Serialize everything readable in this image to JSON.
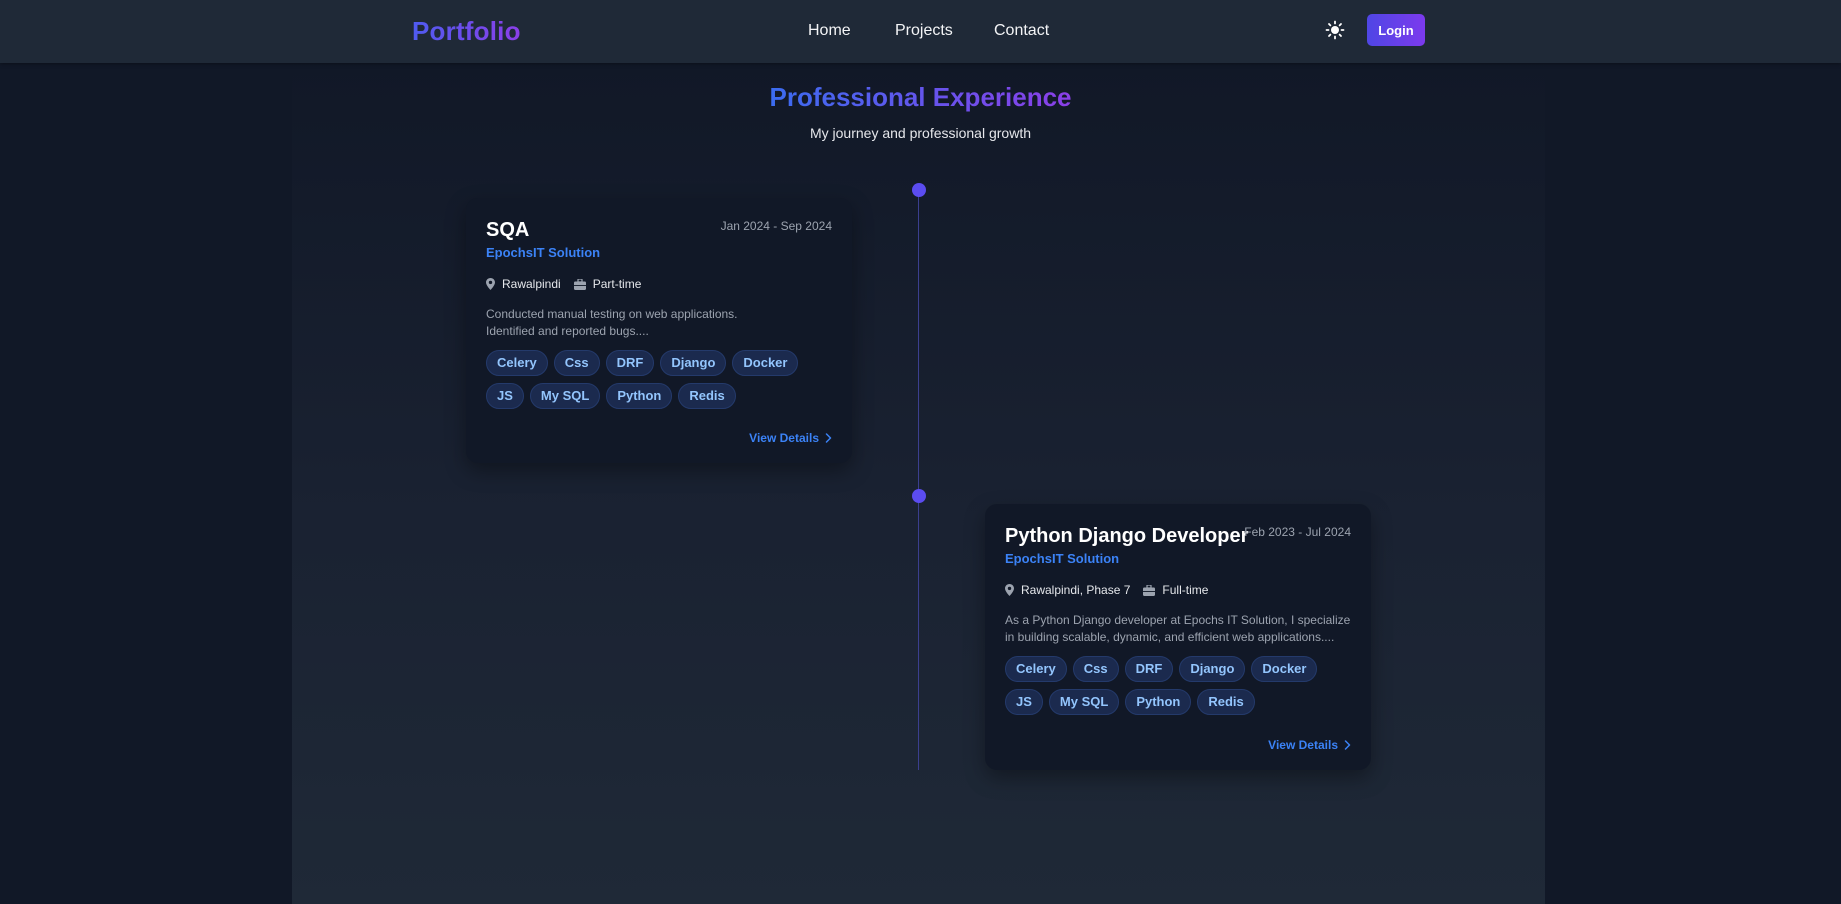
{
  "header": {
    "logo": "Portfolio",
    "nav": [
      {
        "label": "Home"
      },
      {
        "label": "Projects"
      },
      {
        "label": "Contact"
      }
    ],
    "theme_icon": "sun-icon",
    "login_label": "Login"
  },
  "section": {
    "title": "Professional Experience",
    "subtitle": "My journey and professional growth"
  },
  "experiences": [
    {
      "title": "SQA",
      "date": "Jan 2024 - Sep 2024",
      "company": "EpochsIT Solution",
      "location": "Rawalpindi",
      "type": "Part-time",
      "description": "Conducted manual testing on web applications.\nIdentified and reported bugs....",
      "tags": [
        "Celery",
        "Css",
        "DRF",
        "Django",
        "Docker",
        "JS",
        "My SQL",
        "Python",
        "Redis"
      ],
      "link_label": "View Details"
    },
    {
      "title": "Python Django Developer",
      "date": "Feb 2023 - Jul 2024",
      "company": "EpochsIT Solution",
      "location": "Rawalpindi, Phase 7",
      "type": "Full-time",
      "description": "As a Python Django developer at Epochs IT Solution, I specialize in building scalable, dynamic, and efficient web applications....",
      "tags": [
        "Celery",
        "Css",
        "DRF",
        "Django",
        "Docker",
        "JS",
        "My SQL",
        "Python",
        "Redis"
      ],
      "link_label": "View Details"
    }
  ],
  "colors": {
    "accent_blue": "#3b82f6",
    "gradient_start": "#4f46e5",
    "gradient_end": "#7c3aed",
    "background": "#111827",
    "navbar": "#1f2937"
  }
}
